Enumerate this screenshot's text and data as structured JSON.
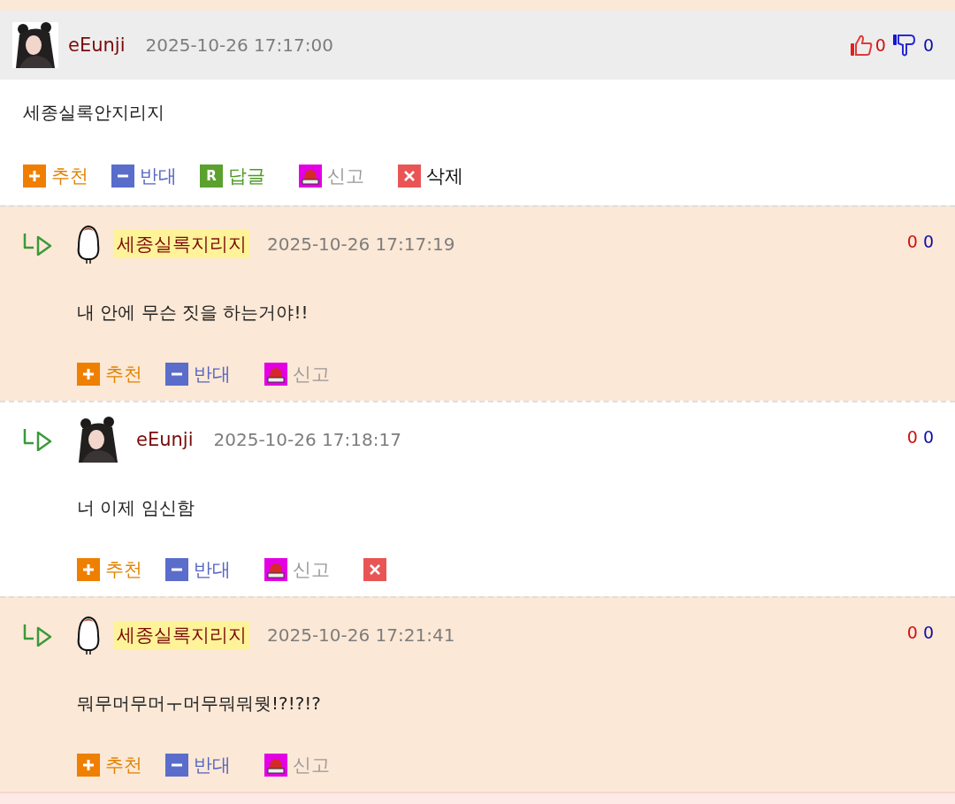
{
  "comment": {
    "author": "eEunji",
    "avatar": {
      "kind": "character"
    },
    "author_highlighted": false,
    "time": "2025-10-26 17:17:00",
    "likes": "0",
    "dislikes": "0",
    "text": "세종실록안지리지",
    "actions": [
      {
        "kind": "recommend",
        "label": "추천"
      },
      {
        "kind": "oppose",
        "label": "반대"
      },
      {
        "kind": "reply",
        "icon_text": "R",
        "label": "답글"
      },
      {
        "kind": "report",
        "label": "신고"
      },
      {
        "kind": "delete",
        "label": "삭제"
      }
    ]
  },
  "replies": [
    {
      "author": "세종실록지리지",
      "avatar": {
        "kind": "bird"
      },
      "author_highlighted": true,
      "time": "2025-10-26 17:17:19",
      "likes": "0",
      "dislikes": "0",
      "text": "내 안에 무슨 짓을 하는거야!!",
      "actions": [
        {
          "kind": "recommend",
          "label": "추천"
        },
        {
          "kind": "oppose",
          "label": "반대"
        },
        {
          "kind": "report",
          "label": "신고"
        }
      ]
    },
    {
      "author": "eEunji",
      "avatar": {
        "kind": "character"
      },
      "author_highlighted": false,
      "time": "2025-10-26 17:18:17",
      "likes": "0",
      "dislikes": "0",
      "text": "너 이제 임신함",
      "actions": [
        {
          "kind": "recommend",
          "label": "추천"
        },
        {
          "kind": "oppose",
          "label": "반대"
        },
        {
          "kind": "report",
          "label": "신고"
        },
        {
          "kind": "delete"
        }
      ]
    },
    {
      "author": "세종실록지리지",
      "avatar": {
        "kind": "bird"
      },
      "author_highlighted": true,
      "time": "2025-10-26 17:21:41",
      "likes": "0",
      "dislikes": "0",
      "text": "뭐무머무머ㅜ머무뭐뭐뭣!?!?!?",
      "actions": [
        {
          "kind": "recommend",
          "label": "추천"
        },
        {
          "kind": "oppose",
          "label": "반대"
        },
        {
          "kind": "report",
          "label": "신고"
        }
      ]
    }
  ]
}
